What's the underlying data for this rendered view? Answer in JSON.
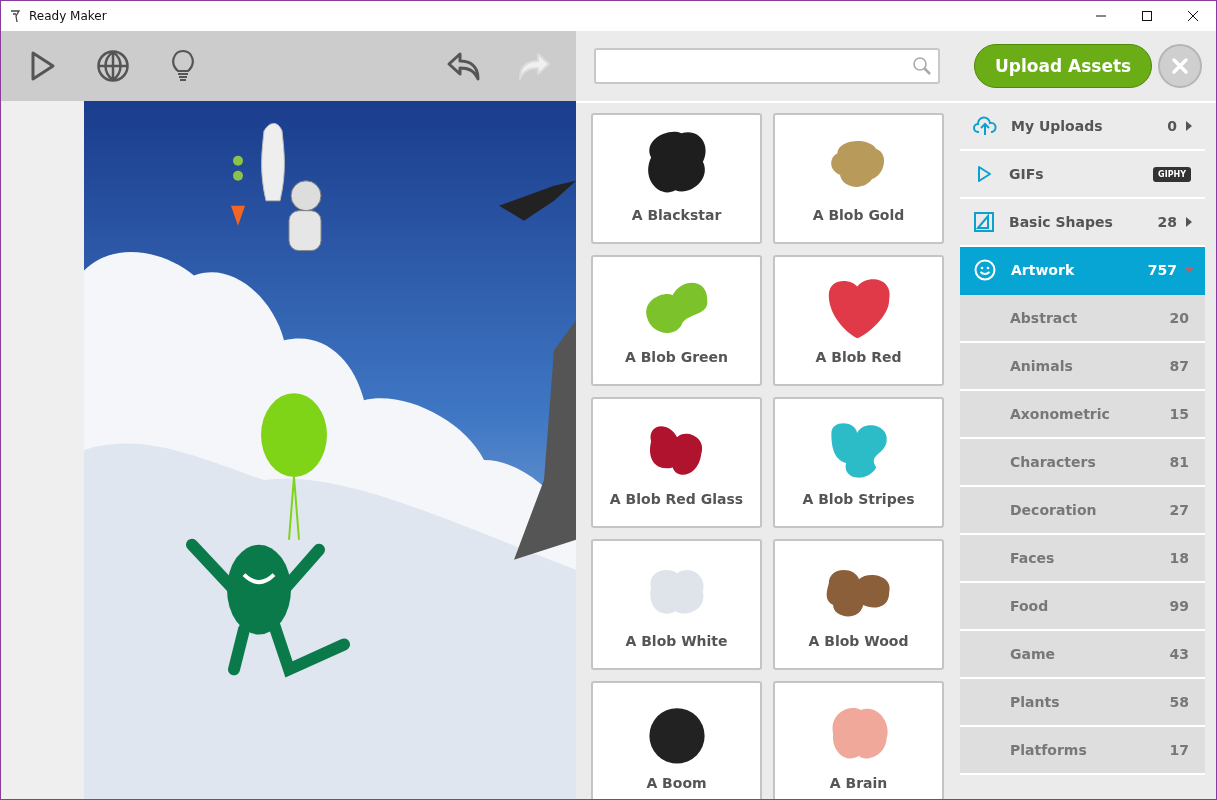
{
  "window": {
    "title": "Ready Maker"
  },
  "upload_button": "Upload Assets",
  "assets": [
    {
      "name": "A Blackstar",
      "color": "#1e1e1e"
    },
    {
      "name": "A Blob Gold",
      "color": "#b89a5a"
    },
    {
      "name": "A Blob Green",
      "color": "#7cc22a"
    },
    {
      "name": "A Blob Red",
      "color": "#e03a48"
    },
    {
      "name": "A Blob Red Glass",
      "color": "#b0132e"
    },
    {
      "name": "A Blob Stripes",
      "color": "#2cbcc8"
    },
    {
      "name": "A Blob White",
      "color": "#dfe4ea"
    },
    {
      "name": "A Blob Wood",
      "color": "#8a5f3a"
    },
    {
      "name": "A Boom",
      "color": "#222222"
    },
    {
      "name": "A Brain",
      "color": "#f0a89a"
    }
  ],
  "categories": [
    {
      "kind": "uploads",
      "label": "My Uploads",
      "count": "0",
      "expanded": false,
      "selected": false
    },
    {
      "kind": "gifs",
      "label": "GIFs",
      "badge": "GIPHY",
      "selected": false
    },
    {
      "kind": "shapes",
      "label": "Basic Shapes",
      "count": "28",
      "expanded": false,
      "selected": false
    },
    {
      "kind": "artwork",
      "label": "Artwork",
      "count": "757",
      "expanded": true,
      "selected": true
    },
    {
      "kind": "sub",
      "label": "Abstract",
      "count": "20",
      "selected": false
    },
    {
      "kind": "sub",
      "label": "Animals",
      "count": "87",
      "selected": false
    },
    {
      "kind": "sub",
      "label": "Axonometric",
      "count": "15",
      "selected": false
    },
    {
      "kind": "sub",
      "label": "Characters",
      "count": "81",
      "selected": false
    },
    {
      "kind": "sub",
      "label": "Decoration",
      "count": "27",
      "selected": false
    },
    {
      "kind": "sub",
      "label": "Faces",
      "count": "18",
      "selected": false
    },
    {
      "kind": "sub",
      "label": "Food",
      "count": "99",
      "selected": false
    },
    {
      "kind": "sub",
      "label": "Game",
      "count": "43",
      "selected": false
    },
    {
      "kind": "sub",
      "label": "Plants",
      "count": "58",
      "selected": false
    },
    {
      "kind": "sub",
      "label": "Platforms",
      "count": "17",
      "selected": false
    }
  ]
}
